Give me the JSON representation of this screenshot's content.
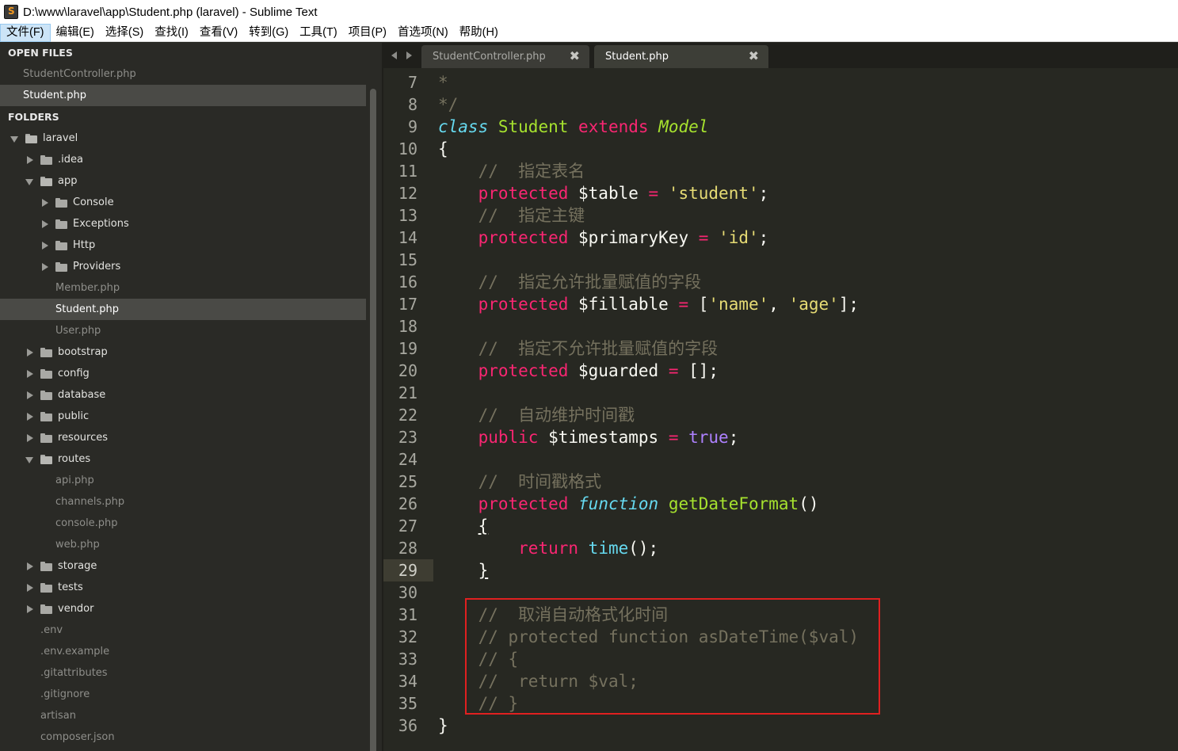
{
  "window": {
    "title": "D:\\www\\laravel\\app\\Student.php (laravel) - Sublime Text"
  },
  "menu": [
    "文件(F)",
    "编辑(E)",
    "选择(S)",
    "查找(I)",
    "查看(V)",
    "转到(G)",
    "工具(T)",
    "项目(P)",
    "首选项(N)",
    "帮助(H)"
  ],
  "sidebar": {
    "open_files_header": "OPEN FILES",
    "open_files": [
      "StudentController.php",
      "Student.php"
    ],
    "folders_header": "FOLDERS",
    "tree": [
      {
        "label": "laravel",
        "type": "folder",
        "state": "open",
        "depth": 0
      },
      {
        "label": ".idea",
        "type": "folder",
        "state": "closed",
        "depth": 1
      },
      {
        "label": "app",
        "type": "folder",
        "state": "open",
        "depth": 1
      },
      {
        "label": "Console",
        "type": "folder",
        "state": "closed",
        "depth": 2
      },
      {
        "label": "Exceptions",
        "type": "folder",
        "state": "closed",
        "depth": 2
      },
      {
        "label": "Http",
        "type": "folder",
        "state": "closed",
        "depth": 2
      },
      {
        "label": "Providers",
        "type": "folder",
        "state": "closed",
        "depth": 2
      },
      {
        "label": "Member.php",
        "type": "file",
        "depth": 2
      },
      {
        "label": "Student.php",
        "type": "file",
        "depth": 2,
        "selected": true
      },
      {
        "label": "User.php",
        "type": "file",
        "depth": 2
      },
      {
        "label": "bootstrap",
        "type": "folder",
        "state": "closed",
        "depth": 1
      },
      {
        "label": "config",
        "type": "folder",
        "state": "closed",
        "depth": 1
      },
      {
        "label": "database",
        "type": "folder",
        "state": "closed",
        "depth": 1
      },
      {
        "label": "public",
        "type": "folder",
        "state": "closed",
        "depth": 1
      },
      {
        "label": "resources",
        "type": "folder",
        "state": "closed",
        "depth": 1
      },
      {
        "label": "routes",
        "type": "folder",
        "state": "open",
        "depth": 1
      },
      {
        "label": "api.php",
        "type": "file",
        "depth": 2
      },
      {
        "label": "channels.php",
        "type": "file",
        "depth": 2
      },
      {
        "label": "console.php",
        "type": "file",
        "depth": 2
      },
      {
        "label": "web.php",
        "type": "file",
        "depth": 2
      },
      {
        "label": "storage",
        "type": "folder",
        "state": "closed",
        "depth": 1
      },
      {
        "label": "tests",
        "type": "folder",
        "state": "closed",
        "depth": 1
      },
      {
        "label": "vendor",
        "type": "folder",
        "state": "closed",
        "depth": 1
      },
      {
        "label": ".env",
        "type": "file",
        "depth": 1
      },
      {
        "label": ".env.example",
        "type": "file",
        "depth": 1
      },
      {
        "label": ".gitattributes",
        "type": "file",
        "depth": 1
      },
      {
        "label": ".gitignore",
        "type": "file",
        "depth": 1
      },
      {
        "label": "artisan",
        "type": "file",
        "depth": 1
      },
      {
        "label": "composer.json",
        "type": "file",
        "depth": 1
      }
    ]
  },
  "tabs": [
    {
      "label": "StudentController.php",
      "close": "✖"
    },
    {
      "label": "Student.php",
      "close": "✖",
      "active": true
    }
  ],
  "editor": {
    "current_line": 29,
    "lines": [
      {
        "n": 7,
        "tokens": [
          [
            "c-comment",
            "*"
          ]
        ]
      },
      {
        "n": 8,
        "tokens": [
          [
            "c-comment",
            "*/"
          ]
        ]
      },
      {
        "n": 9,
        "tokens": [
          [
            "c-storage",
            "class"
          ],
          [
            "c-plain",
            " "
          ],
          [
            "c-class",
            "Student"
          ],
          [
            "c-plain",
            " "
          ],
          [
            "c-kw",
            "extends"
          ],
          [
            "c-plain",
            " "
          ],
          [
            "c-inherit",
            "Model"
          ]
        ]
      },
      {
        "n": 10,
        "tokens": [
          [
            "c-plain",
            "{"
          ]
        ]
      },
      {
        "n": 11,
        "tokens": [
          [
            "c-plain",
            "    "
          ],
          [
            "c-comment",
            "//  指定表名"
          ]
        ]
      },
      {
        "n": 12,
        "tokens": [
          [
            "c-plain",
            "    "
          ],
          [
            "c-kw",
            "protected"
          ],
          [
            "c-plain",
            " $table "
          ],
          [
            "c-kw",
            "="
          ],
          [
            "c-plain",
            " "
          ],
          [
            "c-str",
            "'student'"
          ],
          [
            "c-plain",
            ";"
          ]
        ]
      },
      {
        "n": 13,
        "tokens": [
          [
            "c-plain",
            "    "
          ],
          [
            "c-comment",
            "//  指定主键"
          ]
        ]
      },
      {
        "n": 14,
        "tokens": [
          [
            "c-plain",
            "    "
          ],
          [
            "c-kw",
            "protected"
          ],
          [
            "c-plain",
            " $primaryKey "
          ],
          [
            "c-kw",
            "="
          ],
          [
            "c-plain",
            " "
          ],
          [
            "c-str",
            "'id'"
          ],
          [
            "c-plain",
            ";"
          ]
        ]
      },
      {
        "n": 15,
        "tokens": []
      },
      {
        "n": 16,
        "tokens": [
          [
            "c-plain",
            "    "
          ],
          [
            "c-comment",
            "//  指定允许批量赋值的字段"
          ]
        ]
      },
      {
        "n": 17,
        "tokens": [
          [
            "c-plain",
            "    "
          ],
          [
            "c-kw",
            "protected"
          ],
          [
            "c-plain",
            " $fillable "
          ],
          [
            "c-kw",
            "="
          ],
          [
            "c-plain",
            " ["
          ],
          [
            "c-str",
            "'name'"
          ],
          [
            "c-plain",
            ", "
          ],
          [
            "c-str",
            "'age'"
          ],
          [
            "c-plain",
            "];"
          ]
        ]
      },
      {
        "n": 18,
        "tokens": []
      },
      {
        "n": 19,
        "tokens": [
          [
            "c-plain",
            "    "
          ],
          [
            "c-comment",
            "//  指定不允许批量赋值的字段"
          ]
        ]
      },
      {
        "n": 20,
        "tokens": [
          [
            "c-plain",
            "    "
          ],
          [
            "c-kw",
            "protected"
          ],
          [
            "c-plain",
            " $guarded "
          ],
          [
            "c-kw",
            "="
          ],
          [
            "c-plain",
            " [];"
          ]
        ]
      },
      {
        "n": 21,
        "tokens": []
      },
      {
        "n": 22,
        "tokens": [
          [
            "c-plain",
            "    "
          ],
          [
            "c-comment",
            "//  自动维护时间戳"
          ]
        ]
      },
      {
        "n": 23,
        "tokens": [
          [
            "c-plain",
            "    "
          ],
          [
            "c-kw",
            "public"
          ],
          [
            "c-plain",
            " $timestamps "
          ],
          [
            "c-kw",
            "="
          ],
          [
            "c-plain",
            " "
          ],
          [
            "c-const",
            "true"
          ],
          [
            "c-plain",
            ";"
          ]
        ]
      },
      {
        "n": 24,
        "tokens": []
      },
      {
        "n": 25,
        "tokens": [
          [
            "c-plain",
            "    "
          ],
          [
            "c-comment",
            "//  时间戳格式"
          ]
        ]
      },
      {
        "n": 26,
        "tokens": [
          [
            "c-plain",
            "    "
          ],
          [
            "c-kw",
            "protected"
          ],
          [
            "c-plain",
            " "
          ],
          [
            "c-storage",
            "function"
          ],
          [
            "c-plain",
            " "
          ],
          [
            "c-func",
            "getDateFormat"
          ],
          [
            "c-plain",
            "()"
          ]
        ]
      },
      {
        "n": 27,
        "tokens": [
          [
            "c-plain",
            "    "
          ],
          [
            "c-plain c-ul",
            "{"
          ]
        ]
      },
      {
        "n": 28,
        "tokens": [
          [
            "c-plain",
            "        "
          ],
          [
            "c-kw",
            "return"
          ],
          [
            "c-plain",
            " "
          ],
          [
            "c-builtin",
            "time"
          ],
          [
            "c-plain",
            "();"
          ]
        ]
      },
      {
        "n": 29,
        "tokens": [
          [
            "c-plain",
            "    "
          ],
          [
            "c-plain c-ul",
            "}"
          ]
        ]
      },
      {
        "n": 30,
        "tokens": []
      },
      {
        "n": 31,
        "tokens": [
          [
            "c-plain",
            "    "
          ],
          [
            "c-comment",
            "//  取消自动格式化时间"
          ]
        ]
      },
      {
        "n": 32,
        "tokens": [
          [
            "c-plain",
            "    "
          ],
          [
            "c-comment",
            "// protected function asDateTime($val)"
          ]
        ]
      },
      {
        "n": 33,
        "tokens": [
          [
            "c-plain",
            "    "
          ],
          [
            "c-comment",
            "// {"
          ]
        ]
      },
      {
        "n": 34,
        "tokens": [
          [
            "c-plain",
            "    "
          ],
          [
            "c-comment",
            "//  return $val;"
          ]
        ]
      },
      {
        "n": 35,
        "tokens": [
          [
            "c-plain",
            "    "
          ],
          [
            "c-comment",
            "// }"
          ]
        ]
      },
      {
        "n": 36,
        "tokens": [
          [
            "c-plain",
            "}"
          ]
        ]
      }
    ]
  },
  "colors": {
    "editor_bg": "#272822",
    "keyword": "#f92672",
    "storage": "#66d9ef",
    "class_name": "#a6e22e",
    "string": "#e6db74",
    "constant": "#ae81ff",
    "comment": "#75715e",
    "annotation_box": "#e02020"
  }
}
